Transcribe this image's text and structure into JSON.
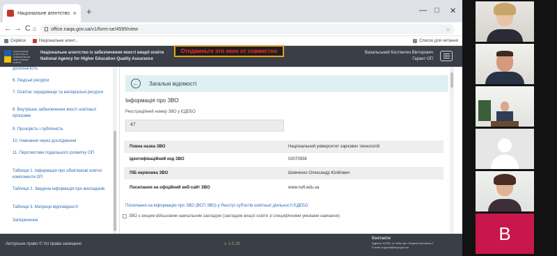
{
  "browser": {
    "tab_title": "Національне агентство із забез",
    "tab_close": "×",
    "new_tab": "+",
    "window_controls": [
      "—",
      "□",
      "✕"
    ],
    "nav_back": "←",
    "nav_forward": "→",
    "nav_reload": "C",
    "nav_home": "⌂",
    "url": "office.naqa.gov.ua/v1/form-se/4595/view",
    "bookmark_star": "☆",
    "bookmarks": [
      "Сервіси",
      "Національне агент..."
    ],
    "bookmarks_right": "Список для читання"
  },
  "site": {
    "agency_uk": "Національне агентство із забезпечення якості вищої освіти",
    "agency_en": "National Agency for Higher Education Quality Assurance",
    "logo_text": "НАЦІОНАЛЬНЕ АГЕНТСТВО ІЗ ЗАБЕЗПЕЧЕННЯ ЯКОСТІ ВИЩОЇ ОСВІТИ",
    "overlay_message": "Отодвиньте это окно от совместно",
    "user_name": "Вахальський Костянтин Вікторович",
    "user_role": "Гарант ОП"
  },
  "sidebar": {
    "items": [
      "досконалість",
      "6. Людські ресурси",
      "7. Освітнє середовище та матеріальні ресурси",
      "8. Внутрішнє забезпечення якості освітньої програми",
      "9. Прозорість і публічність",
      "10. Навчання через дослідження",
      "11. Перспективи подальшого розвитку ОП",
      "Таблиця 1. Інформація про обов'язкові освітні компоненти ОП",
      "Таблиця 2. Зведена інформація про викладачів",
      "Таблиця 3. Матриця відповідності",
      "Заперечення"
    ]
  },
  "main": {
    "section_title": "Загальні відомості",
    "info_title": "Інформація про ЗВО",
    "registry_label": "Реєстраційний номер ЗВО у ЄДЕБО",
    "registry_value": "47",
    "rows": [
      {
        "k": "Повна назва ЗВО",
        "v": "Національний університет харчових технологій"
      },
      {
        "k": "Ідентифікаційний код ЗВО",
        "v": "02070938"
      },
      {
        "k": "ПІБ керівника ЗВО",
        "v": "Шевченко Олександр Юлійович"
      },
      {
        "k": "Посилання на офіційний веб-сайт ЗВО",
        "v": "www.nuft.edu.ua"
      }
    ],
    "registry_link": "Посилання на інформацію про ЗВО (ВСП ЗВО) у Реєстрі суб'єктів освітньої діяльності ЄДЕБО",
    "checkbox_label": "ЗВО є вищим військовим навчальним закладом (закладом вищої освіти зі специфічними умовами навчання)"
  },
  "footer": {
    "copyright": "Авторське право © Усі права захищено",
    "version": "v. 1.0.28",
    "contacts_title": "Контакти",
    "address": "Адреса: 01001, м. Київ, вул. Бориса Грінченка,1",
    "email": "E-mail: support@naqa.gov.ua"
  },
  "participants": {
    "letter_tile": "B"
  },
  "colors": {
    "header_bg": "#3a3f47",
    "section_bar": "#dff0f3",
    "link": "#2f6db5",
    "overlay_border": "#e8a21a",
    "overlay_text": "#ff2a2a",
    "letter_tile_bg": "#c8174a"
  }
}
